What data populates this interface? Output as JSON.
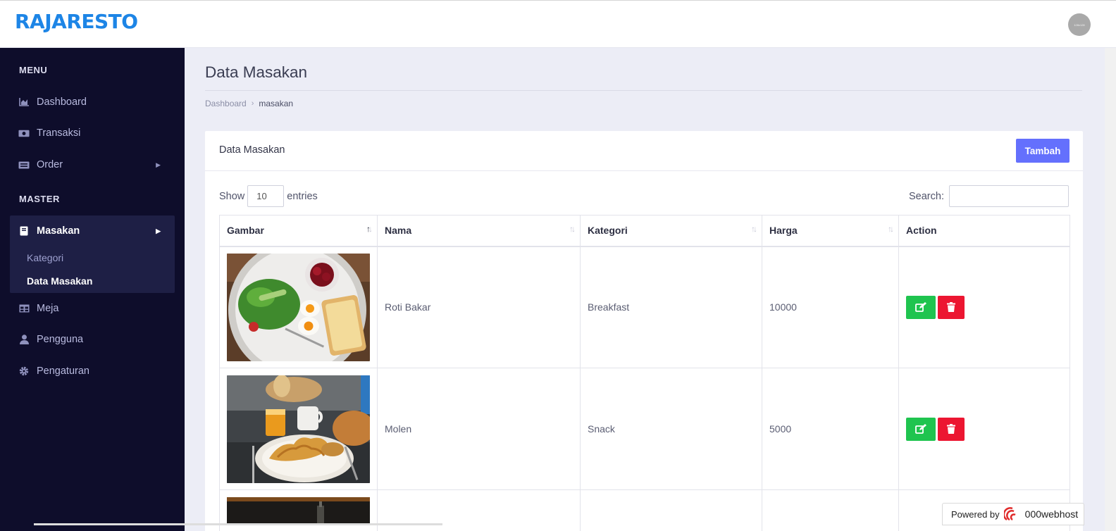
{
  "app": {
    "brand": "RAJARESTO",
    "avatar_text": "128x128"
  },
  "sidebar": {
    "sections": [
      "MENU",
      "MASTER"
    ],
    "items": [
      {
        "label": "Dashboard",
        "icon": "chart-area-icon"
      },
      {
        "label": "Transaksi",
        "icon": "money-bill-icon"
      },
      {
        "label": "Order",
        "icon": "keyboard-icon"
      },
      {
        "label": "Masakan",
        "icon": "book-icon"
      },
      {
        "label": "Meja",
        "icon": "table-icon"
      },
      {
        "label": "Pengguna",
        "icon": "user-icon"
      },
      {
        "label": "Pengaturan",
        "icon": "gear-icon"
      }
    ],
    "sub_items": [
      "Kategori",
      "Data Masakan"
    ]
  },
  "page": {
    "title": "Data Masakan",
    "breadcrumb": [
      "Dashboard",
      "masakan"
    ]
  },
  "card": {
    "title": "Data Masakan",
    "add_label": "Tambah",
    "show_label": "Show",
    "entries_value": "10",
    "entries_label": "entries",
    "search_label": "Search:",
    "search_value": ""
  },
  "table": {
    "columns": [
      "Gambar",
      "Nama",
      "Kategori",
      "Harga",
      "Action"
    ],
    "rows": [
      {
        "nama": "Roti Bakar",
        "kategori": "Breakfast",
        "harga": "10000",
        "image": "breakfast-plate-photo"
      },
      {
        "nama": "Molen",
        "kategori": "Snack",
        "harga": "5000",
        "image": "croissant-breakfast-photo"
      },
      {
        "nama": "",
        "kategori": "",
        "harga": "",
        "image": "dark-bottle-photo"
      }
    ]
  },
  "footer_badge": {
    "label": "Powered by",
    "brand": "000webhost"
  },
  "colors": {
    "brand": "#1d85e6",
    "sidebar_bg": "#0e0d2b",
    "primary_button": "#6470fd",
    "edit_button": "#1fc44f",
    "delete_button": "#ec1631",
    "page_bg": "#ecedf6"
  }
}
